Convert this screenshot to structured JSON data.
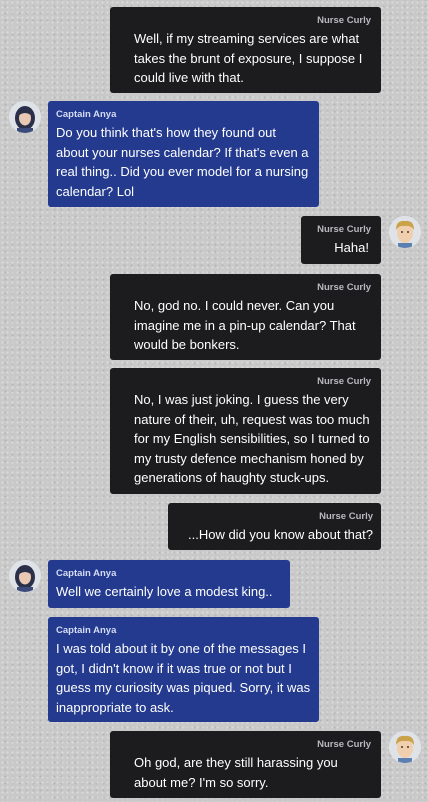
{
  "messages": [
    {
      "sender": "Nurse Curly",
      "text": "Well, if my streaming services are what takes the brunt of exposure, I suppose I could live with that."
    },
    {
      "sender": "Captain Anya",
      "text": "Do you think that's how they found out about your nurses calendar? If that's even a real thing.. Did you ever model for a nursing calendar? Lol"
    },
    {
      "sender": "Nurse Curly",
      "text": "Haha!"
    },
    {
      "sender": "Nurse Curly",
      "text": "No, god no. I could never. Can you imagine me in a pin-up calendar? That would be bonkers."
    },
    {
      "sender": "Nurse Curly",
      "text": "No, I was just joking. I guess the very nature of their, uh, request was too much for my English sensibilities, so I turned to my trusty defence mechanism honed by generations of haughty stuck-ups."
    },
    {
      "sender": "Nurse Curly",
      "text": "...How did you know about that?"
    },
    {
      "sender": "Captain Anya",
      "text": "Well we certainly love a modest king.."
    },
    {
      "sender": "Captain Anya",
      "text": "I was told about it by one of the messages I got, I didn't know if it was true or not but I guess my curiosity was piqued. Sorry, it was inappropriate to ask."
    },
    {
      "sender": "Nurse Curly",
      "text": "Oh god, are they still harassing you about me? I'm so sorry."
    }
  ],
  "avatars": {
    "captain_anya": {
      "icon": "captain-anya-avatar-icon",
      "hair": "#2a2f4a",
      "skin": "#e9c9b4"
    },
    "nurse_curly": {
      "icon": "nurse-curly-avatar-icon",
      "hair": "#caa24a",
      "skin": "#f0cfae"
    }
  },
  "colors": {
    "curly_bubble": "#1c1c1f",
    "anya_bubble": "#233a8e",
    "background": "#c9c9c9"
  }
}
